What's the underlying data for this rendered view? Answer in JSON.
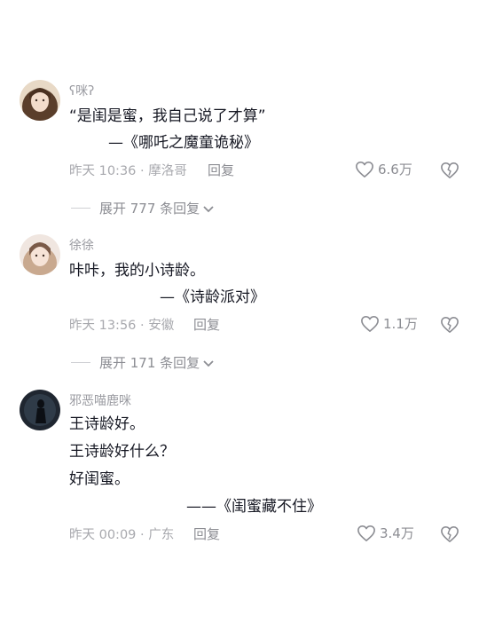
{
  "comments": [
    {
      "username": "ʕ咪ʔ",
      "lines": [
        "“是闺是蜜，我自己说了才算”",
        "—《哪吒之魔童诡秘》"
      ],
      "meta": "昨天 10:36 · 摩洛哥",
      "reply_label": "回复",
      "likes": "6.6万",
      "expand_label": "展开 777 条回复"
    },
    {
      "username": "徐徐",
      "lines": [
        "咔咔，我的小诗龄。",
        "—《诗龄派对》"
      ],
      "meta": "昨天 13:56 · 安徽",
      "reply_label": "回复",
      "likes": "1.1万",
      "expand_label": "展开 171 条回复"
    },
    {
      "username": "邪恶喵鹿咪",
      "lines": [
        "王诗龄好。",
        "王诗龄好什么？",
        "好闺蜜。",
        "——《闺蜜藏不住》"
      ],
      "meta": "昨天 00:09 · 广东",
      "reply_label": "回复",
      "likes": "3.4万"
    }
  ],
  "icons": {
    "like": "heart-outline-icon",
    "dislike": "broken-heart-icon",
    "expand": "chevron-down-icon"
  },
  "colors": {
    "text": "#161823",
    "secondary": "#9a9ba1",
    "icon": "#8c8d93"
  }
}
